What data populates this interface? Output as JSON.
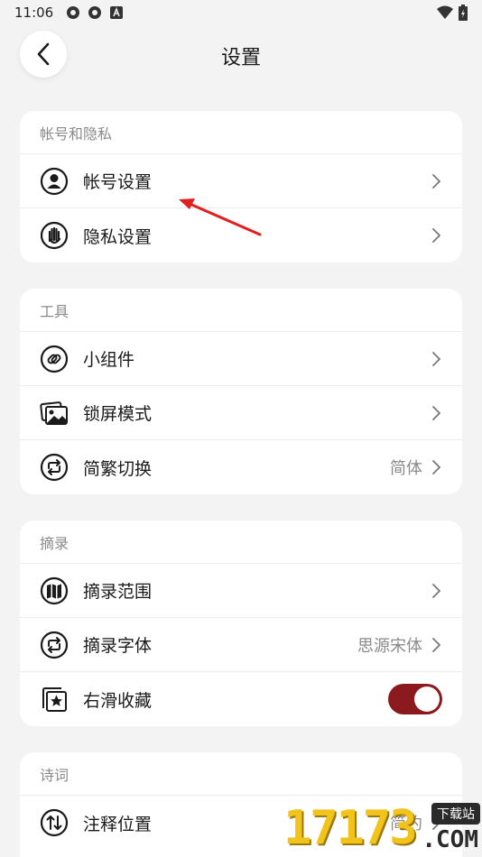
{
  "status_bar": {
    "time": "11:06"
  },
  "header": {
    "title": "设置"
  },
  "sections": [
    {
      "title": "帐号和隐私",
      "items": [
        {
          "label": "帐号设置",
          "icon": "person-icon"
        },
        {
          "label": "隐私设置",
          "icon": "hand-icon"
        }
      ]
    },
    {
      "title": "工具",
      "items": [
        {
          "label": "小组件",
          "icon": "link-icon"
        },
        {
          "label": "锁屏模式",
          "icon": "image-icon"
        },
        {
          "label": "简繁切换",
          "icon": "swap-icon",
          "value": "简体"
        }
      ]
    },
    {
      "title": "摘录",
      "items": [
        {
          "label": "摘录范围",
          "icon": "map-icon"
        },
        {
          "label": "摘录字体",
          "icon": "swap-icon",
          "value": "思源宋体"
        },
        {
          "label": "右滑收藏",
          "icon": "star-collection-icon",
          "toggle": true
        }
      ]
    },
    {
      "title": "诗词",
      "items": [
        {
          "label": "注释位置",
          "icon": "sort-arrows-icon",
          "value": "简约"
        }
      ]
    }
  ],
  "colors": {
    "accent": "#8b1a1f",
    "annotation": "#e02020",
    "background": "#f3f3f3"
  },
  "watermark": {
    "digits": "17173",
    "badge": "下载站",
    "domain": ".COM"
  }
}
